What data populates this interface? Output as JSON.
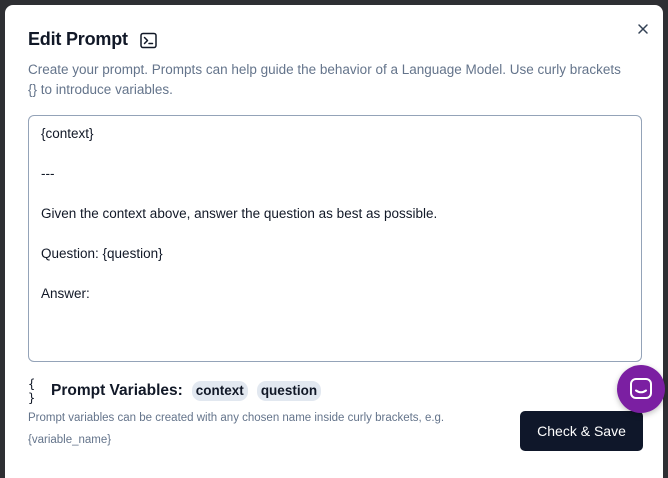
{
  "modal": {
    "title": "Edit Prompt",
    "description": "Create your prompt. Prompts can help guide the behavior of a Language Model. Use curly brackets {} to introduce variables.",
    "prompt_text": "{context}\n\n---\n\nGiven the context above, answer the question as best as possible.\n\nQuestion: {question}\n\nAnswer:",
    "variables_icon": "{ }",
    "variables_label": "Prompt Variables:",
    "variables": [
      "context",
      "question"
    ],
    "help_text": "Prompt variables can be created with any chosen name inside curly brackets, e.g. {variable_name}",
    "save_label": "Check & Save"
  },
  "icons": {
    "title_icon": "terminal-icon",
    "close": "close-icon",
    "chat": "chat-icon"
  },
  "colors": {
    "primary_button": "#0f172a",
    "chip_bg": "#e2e8f0",
    "chat_bubble": "#7b1fa2"
  }
}
